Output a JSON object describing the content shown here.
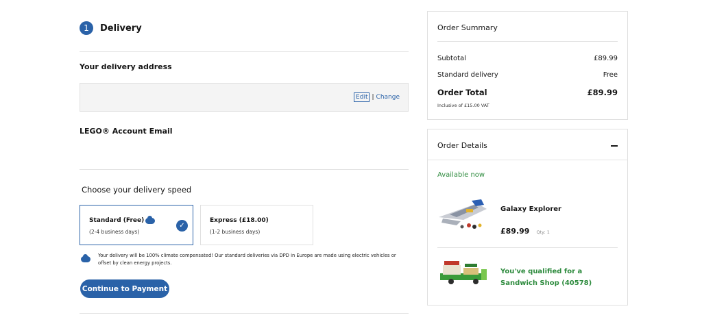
{
  "delivery": {
    "step_number": "1",
    "title": "Delivery",
    "address_label": "Your delivery address",
    "edit_label": "Edit",
    "separator": "|",
    "change_label": "Change",
    "email_label": "LEGO® Account Email",
    "speed_title": "Choose your delivery speed",
    "options": [
      {
        "name": "Standard (Free)",
        "sub": "(2-4 business days)",
        "selected": true
      },
      {
        "name": "Express (£18.00)",
        "sub": "(1-2 business days)",
        "selected": false
      }
    ],
    "climate_note": "Your delivery will be 100% climate compensated! Our standard deliveries via DPD in Europe are made using electric vehicles or offset by clean energy projects.",
    "continue_label": "Continue to Payment"
  },
  "summary": {
    "title": "Order Summary",
    "subtotal_label": "Subtotal",
    "subtotal_value": "£89.99",
    "delivery_label": "Standard delivery",
    "delivery_value": "Free",
    "total_label": "Order Total",
    "total_value": "£89.99",
    "vat_note": "Inclusive of £15.00 VAT"
  },
  "details": {
    "title": "Order Details",
    "availability": "Available now",
    "product": {
      "name": "Galaxy Explorer",
      "price": "£89.99",
      "qty": "Qty: 1"
    },
    "gift": "You've qualified for a Sandwich Shop (40578)"
  },
  "colors": {
    "accent": "#2a62a8",
    "green": "#2e8b3e",
    "border": "#e0e0e0"
  }
}
